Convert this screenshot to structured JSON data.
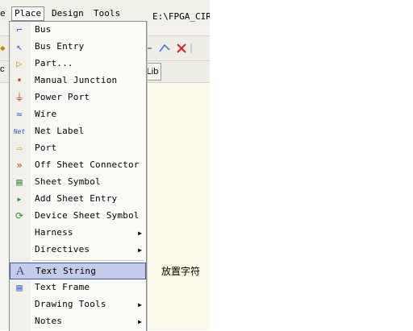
{
  "menubar": {
    "edge_text": "e",
    "menus": [
      {
        "label": "Place",
        "active": true
      },
      {
        "label": "Design",
        "active": false
      },
      {
        "label": "Tools",
        "active": false
      }
    ],
    "path_text": "E:\\FPGA_CIRC"
  },
  "toolbar": {
    "lib_label": "Lib",
    "ctx_text": "c"
  },
  "place_menu": {
    "items": [
      {
        "label": "Bus",
        "icon": "bus-icon",
        "glyph": "⌐",
        "color": "#2b5fd0",
        "submenu": false
      },
      {
        "label": "Bus Entry",
        "icon": "bus-entry-icon",
        "glyph": "↖",
        "color": "#2b5fd0",
        "submenu": false
      },
      {
        "label": "Part...",
        "icon": "part-icon",
        "glyph": "▷",
        "color": "#c48a00",
        "submenu": false
      },
      {
        "label": "Manual Junction",
        "icon": "junction-icon",
        "glyph": "•",
        "color": "#c23a1b",
        "submenu": false
      },
      {
        "label": "Power Port",
        "icon": "power-port-icon",
        "glyph": "⏚",
        "color": "#c23a1b",
        "submenu": false
      },
      {
        "label": "Wire",
        "icon": "wire-icon",
        "glyph": "≈",
        "color": "#2b5fd0",
        "submenu": false
      },
      {
        "label": "Net Label",
        "icon": "net-label-icon",
        "glyph": "Net",
        "color": "#2b5fd0",
        "submenu": false
      },
      {
        "label": "Port",
        "icon": "port-icon",
        "glyph": "⇨",
        "color": "#c48a00",
        "submenu": false
      },
      {
        "label": "Off Sheet Connector",
        "icon": "off-sheet-connector-icon",
        "glyph": "»",
        "color": "#c23a1b",
        "submenu": false
      },
      {
        "label": "Sheet Symbol",
        "icon": "sheet-symbol-icon",
        "glyph": "▤",
        "color": "#2e8b2e",
        "submenu": false
      },
      {
        "label": "Add Sheet Entry",
        "icon": "sheet-entry-icon",
        "glyph": "▸",
        "color": "#2e8b2e",
        "submenu": false
      },
      {
        "label": "Device Sheet Symbol",
        "icon": "device-sheet-icon",
        "glyph": "⟳",
        "color": "#2e8b2e",
        "submenu": false
      },
      {
        "label": "Harness",
        "icon": "",
        "glyph": "",
        "color": "#000000",
        "submenu": true
      },
      {
        "label": "Directives",
        "icon": "",
        "glyph": "",
        "color": "#000000",
        "submenu": true
      },
      {
        "label": "Text String",
        "icon": "text-string-icon",
        "glyph": "A",
        "color": "#2b4f9e",
        "submenu": false,
        "highlight": true
      },
      {
        "label": "Text Frame",
        "icon": "text-frame-icon",
        "glyph": "▤",
        "color": "#2b5fd0",
        "submenu": false
      },
      {
        "label": "Drawing Tools",
        "icon": "",
        "glyph": "",
        "color": "#000000",
        "submenu": true
      },
      {
        "label": "Notes",
        "icon": "",
        "glyph": "",
        "color": "#000000",
        "submenu": true
      }
    ]
  },
  "tooltip": "放置字符"
}
